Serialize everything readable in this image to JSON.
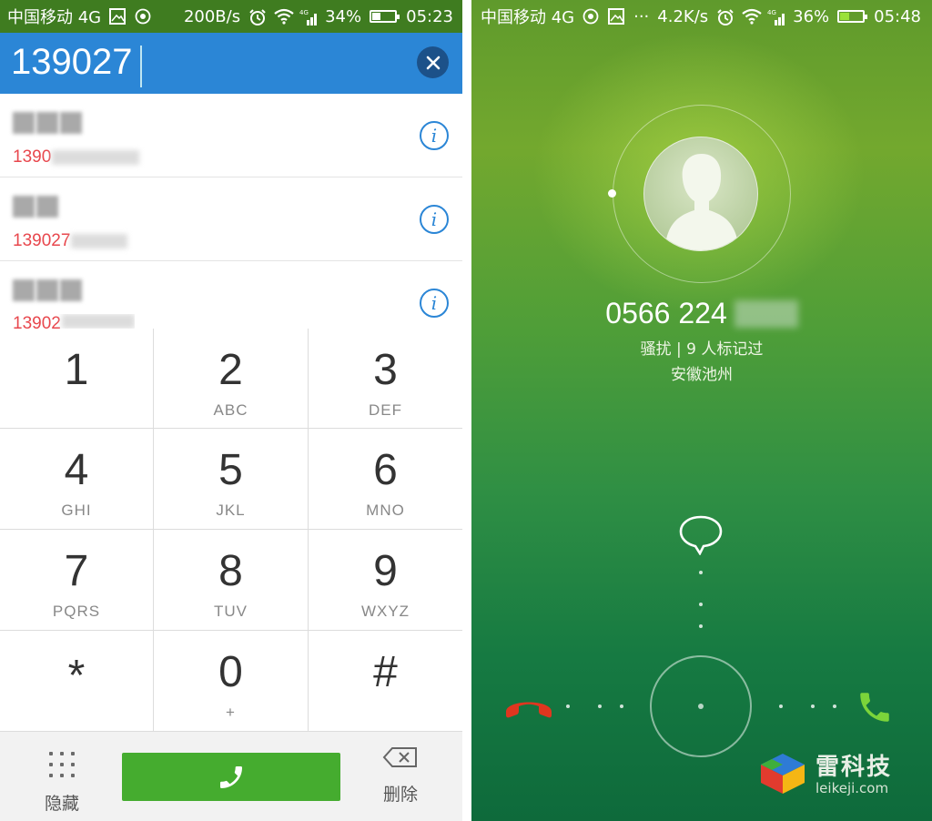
{
  "left_screen": {
    "status": {
      "carrier": "中国移动 4G",
      "speed": "200B/s",
      "battery": "34%",
      "time": "05:23"
    },
    "search": {
      "query": "139027"
    },
    "contacts": [
      {
        "number_prefix": "1390"
      },
      {
        "number_prefix": "139027"
      },
      {
        "number_prefix": "13902"
      }
    ],
    "keys": [
      {
        "digit": "1",
        "letters": ""
      },
      {
        "digit": "2",
        "letters": "ABC"
      },
      {
        "digit": "3",
        "letters": "DEF"
      },
      {
        "digit": "4",
        "letters": "GHI"
      },
      {
        "digit": "5",
        "letters": "JKL"
      },
      {
        "digit": "6",
        "letters": "MNO"
      },
      {
        "digit": "7",
        "letters": "PQRS"
      },
      {
        "digit": "8",
        "letters": "TUV"
      },
      {
        "digit": "9",
        "letters": "WXYZ"
      },
      {
        "digit": "*",
        "letters": ""
      },
      {
        "digit": "0",
        "letters": "+"
      },
      {
        "digit": "#",
        "letters": ""
      }
    ],
    "bottom": {
      "hide_label": "隐藏",
      "delete_label": "删除"
    }
  },
  "right_screen": {
    "status": {
      "carrier": "中国移动 4G",
      "speed": "4.2K/s",
      "battery": "36%",
      "time": "05:48"
    },
    "caller": {
      "number": "0566 224",
      "tag": "骚扰 | 9 人标记过",
      "location": "安徽池州"
    },
    "watermark": {
      "brand": "雷科技",
      "domain": "leikeji.com"
    }
  },
  "colors": {
    "status_green": "#3f7c20",
    "search_blue": "#2b86d6",
    "call_green": "#45ac2f",
    "number_red": "#e8474d"
  }
}
